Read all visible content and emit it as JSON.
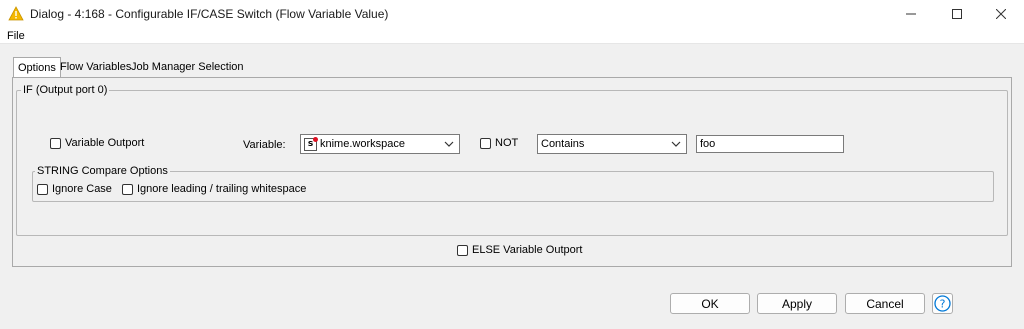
{
  "window": {
    "title": "Dialog - 4:168 - Configurable IF/CASE Switch (Flow Variable Value)",
    "icon": "warning-triangle-icon",
    "controls": [
      "minimize-icon",
      "maximize-icon",
      "close-icon"
    ]
  },
  "menu": {
    "file_label": "File"
  },
  "tabs": [
    {
      "label": "Options",
      "active": true
    },
    {
      "label": "Flow Variables",
      "active": false
    },
    {
      "label": "Job Manager Selection",
      "active": false
    }
  ],
  "if_group": {
    "title": "IF (Output port 0)",
    "variable_outport_label": "Variable Outport",
    "variable_label": "Variable:",
    "variable_value": "knime.workspace",
    "variable_type_icon": "s",
    "not_label": "NOT",
    "operator_value": "Contains",
    "compare_value": "foo",
    "string_options": {
      "title": "STRING Compare Options",
      "ignore_case_label": "Ignore Case",
      "ignore_whitespace_label": "Ignore leading / trailing whitespace"
    }
  },
  "else_label": "ELSE Variable Outport",
  "buttons": {
    "ok": "OK",
    "apply": "Apply",
    "cancel": "Cancel",
    "help": "?"
  },
  "colors": {
    "accent": "#0078d7",
    "warning": "#f5b800"
  }
}
